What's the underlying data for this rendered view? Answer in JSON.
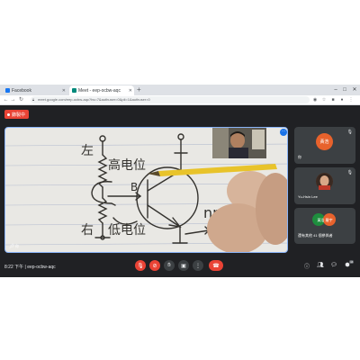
{
  "browser": {
    "tabs": [
      {
        "label": "Facebook",
        "icon_color": "#1877f2",
        "active": false
      },
      {
        "label": "Meet - eep-ocbw-aqc",
        "icon_color": "#00897b",
        "active": true
      }
    ],
    "new_tab": "+",
    "url": "meet.google.com/eep-ocbw-aqc?hs=7&authuser=0&pli=1&authuser=0"
  },
  "meet": {
    "recording_label": "錄製中",
    "main_participant_name": "你",
    "participants": [
      {
        "name": "你",
        "initials": "黃浩",
        "avatar_color": "#e8622c"
      },
      {
        "name": "Yu-Hsin Lee",
        "initials": "",
        "avatar_color": "#7a5a4a"
      },
      {
        "name": "還有其他 41 個參與者",
        "initials": "黃浩 羅宇",
        "avatar_color": "#1e8e3e"
      }
    ],
    "time": "8:22 下午",
    "meeting_code": "eep-ocbw-aqc",
    "participant_count": "44"
  },
  "whiteboard_text": {
    "left_top": "左",
    "left_bottom": "右",
    "label_high": "高电位",
    "label_low": "低电位",
    "label_B": "B",
    "label_npn": "npn",
    "label_E": "E"
  },
  "colors": {
    "accent": "#8ab4f8",
    "danger": "#ea4335",
    "meet_bg": "#202124"
  }
}
